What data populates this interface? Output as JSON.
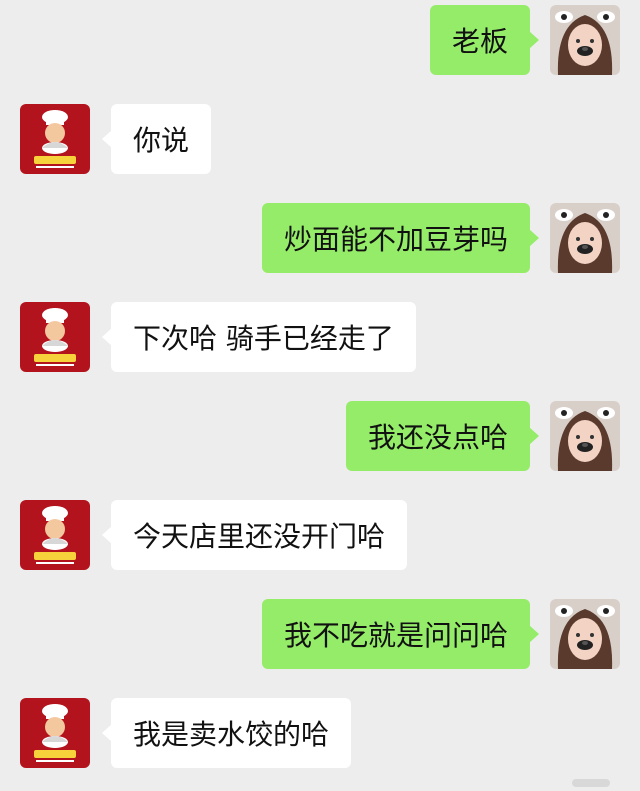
{
  "chat": {
    "self_avatar": "selfie-girl-cow-ears-avatar",
    "shop_avatar": "restaurant-chef-logo-avatar",
    "bubble_colors": {
      "self": "#95ec69",
      "other": "#ffffff",
      "background": "#ededed"
    },
    "messages": [
      {
        "sender": "self",
        "text": "老板"
      },
      {
        "sender": "other",
        "text": "你说"
      },
      {
        "sender": "self",
        "text": "炒面能不加豆芽吗"
      },
      {
        "sender": "other",
        "text": "下次哈 骑手已经走了"
      },
      {
        "sender": "self",
        "text": "我还没点哈"
      },
      {
        "sender": "other",
        "text": "今天店里还没开门哈"
      },
      {
        "sender": "self",
        "text": "我不吃就是问问哈"
      },
      {
        "sender": "other",
        "text": "我是卖水饺的哈"
      }
    ]
  }
}
